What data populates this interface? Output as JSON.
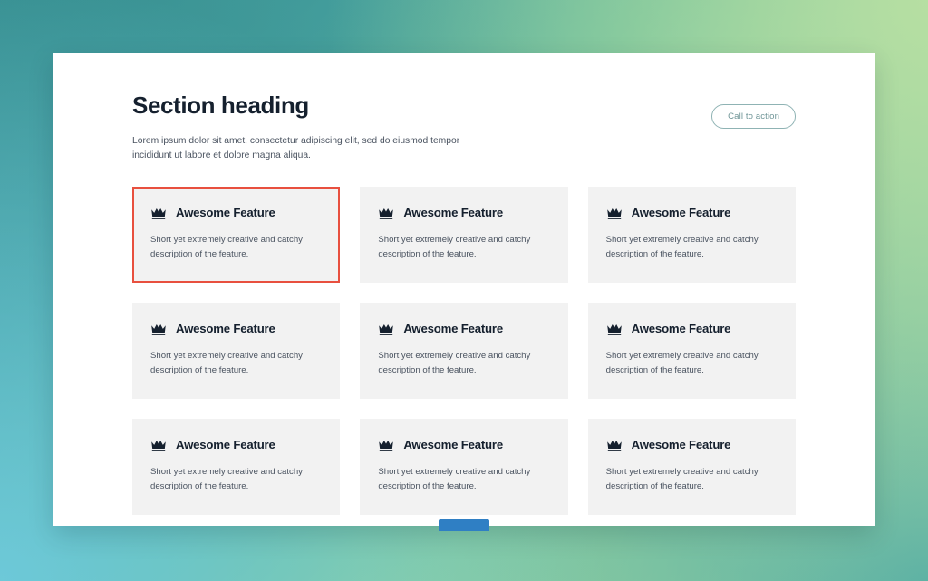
{
  "background": {
    "corner_top_left": "#389092",
    "corner_top_right": "#b9e0a3",
    "corner_bottom_left": "#6ecadc",
    "corner_bottom_right": "#4ba8a4"
  },
  "panel": {
    "background": "#ffffff"
  },
  "header": {
    "title": "Section heading",
    "subtitle": "Lorem ipsum dolor sit amet, consectetur adipiscing elit, sed do eiusmod tempor incididunt ut labore et dolore magna aliqua.",
    "cta_label": "Call to action",
    "cta_border_color": "#8fb3b4",
    "cta_text_color": "#6f9597"
  },
  "features": {
    "icon_name": "crown-icon",
    "selected_index": 0,
    "selected_border_color": "#e8503f",
    "card_background": "#f2f2f2",
    "items": [
      {
        "title": "Awesome Feature",
        "description": "Short yet extremely creative and catchy description of the feature."
      },
      {
        "title": "Awesome Feature",
        "description": "Short yet extremely creative and catchy description of the feature."
      },
      {
        "title": "Awesome Feature",
        "description": "Short yet extremely creative and catchy description of the feature."
      },
      {
        "title": "Awesome Feature",
        "description": "Short yet extremely creative and catchy description of the feature."
      },
      {
        "title": "Awesome Feature",
        "description": "Short yet extremely creative and catchy description of the feature."
      },
      {
        "title": "Awesome Feature",
        "description": "Short yet extremely creative and catchy description of the feature."
      },
      {
        "title": "Awesome Feature",
        "description": "Short yet extremely creative and catchy description of the feature."
      },
      {
        "title": "Awesome Feature",
        "description": "Short yet extremely creative and catchy description of the feature."
      },
      {
        "title": "Awesome Feature",
        "description": "Short yet extremely creative and catchy description of the feature."
      }
    ]
  },
  "bottom_badge": {
    "label": "",
    "color": "#2f7fc4"
  }
}
